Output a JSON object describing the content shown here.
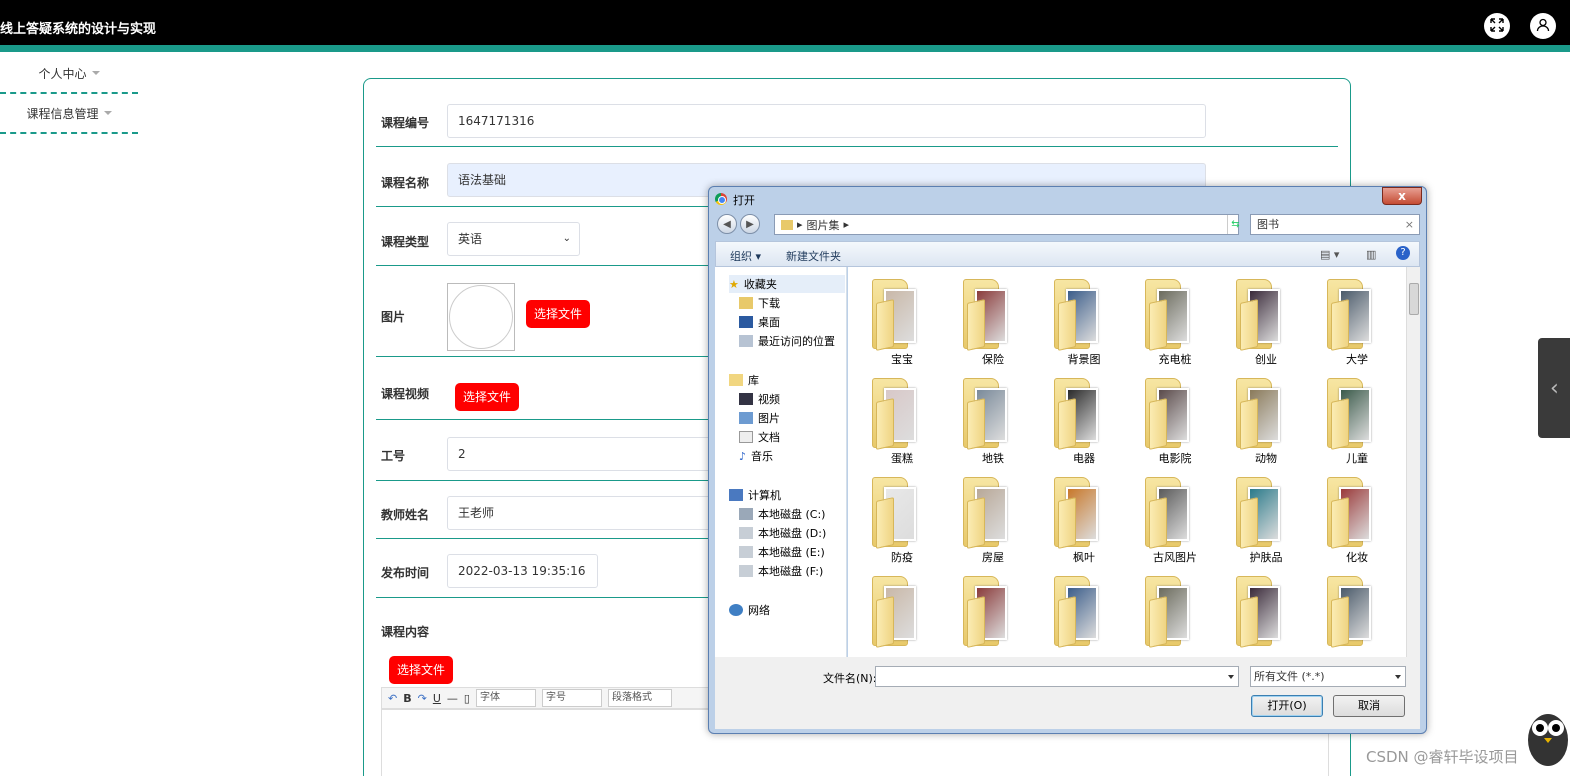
{
  "app": {
    "title": "线上答疑系统的设计与实现"
  },
  "sidebar": {
    "items": [
      {
        "label": "个人中心"
      },
      {
        "label": "课程信息管理"
      }
    ]
  },
  "form": {
    "course_no": {
      "label": "课程编号",
      "value": "1647171316"
    },
    "course_name": {
      "label": "课程名称",
      "value": "语法基础"
    },
    "course_type": {
      "label": "课程类型",
      "value": "英语"
    },
    "image": {
      "label": "图片",
      "button": "选择文件"
    },
    "video": {
      "label": "课程视频",
      "button": "选择文件"
    },
    "job_no": {
      "label": "工号",
      "value": "2"
    },
    "teacher": {
      "label": "教师姓名",
      "value": "王老师"
    },
    "publish_time": {
      "label": "发布时间",
      "value": "2022-03-13 19:35:16"
    },
    "content": {
      "label": "课程内容",
      "button": "选择文件"
    },
    "editor_toolbar": {
      "bold": "B",
      "underline": "U",
      "font": "字体",
      "size": "字号",
      "paragraph": "段落格式"
    }
  },
  "dialog": {
    "title": "打开",
    "close": "x",
    "breadcrumb": "图片集",
    "search_value": "图书",
    "cmd": {
      "organize": "组织",
      "new_folder": "新建文件夹"
    },
    "nav": {
      "favorites": "收藏夹",
      "favorites_items": [
        "下载",
        "桌面",
        "最近访问的位置"
      ],
      "library": "库",
      "library_items": [
        "视频",
        "图片",
        "文档",
        "音乐"
      ],
      "computer": "计算机",
      "computer_items": [
        "本地磁盘 (C:)",
        "本地磁盘 (D:)",
        "本地磁盘 (E:)",
        "本地磁盘 (F:)"
      ],
      "network": "网络"
    },
    "folders": [
      "宝宝",
      "保险",
      "背景图",
      "充电桩",
      "创业",
      "大学",
      "蛋糕",
      "地铁",
      "电器",
      "电影院",
      "动物",
      "儿童",
      "防疫",
      "房屋",
      "枫叶",
      "古风图片",
      "护肤品",
      "化妆"
    ],
    "filename_label": "文件名(N):",
    "filename_value": "",
    "filetype": "所有文件 (*.*)",
    "open_button": "打开(O)",
    "cancel_button": "取消"
  },
  "watermark": "CSDN @睿轩毕设项目",
  "colors": {
    "accent": "#1a9a8a",
    "button_red": "#ff0000",
    "topbar": "#000000"
  }
}
